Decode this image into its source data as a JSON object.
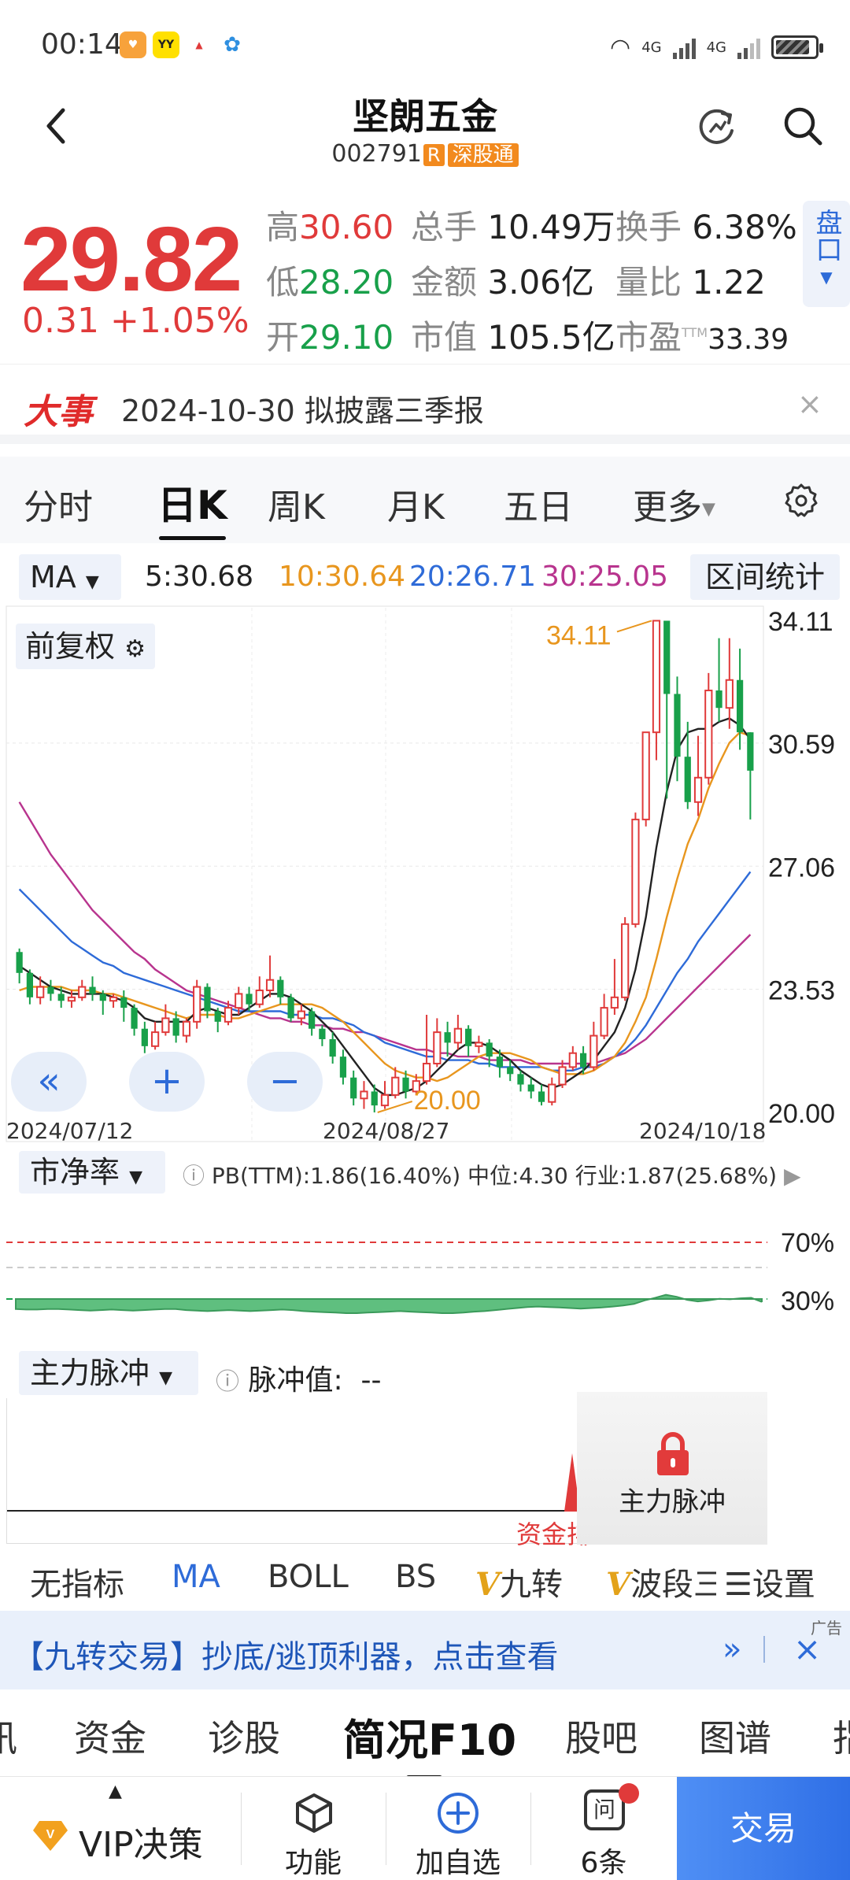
{
  "status_bar": {
    "time": "00:14",
    "network1": "4G",
    "network2": "4G"
  },
  "header": {
    "stock_name": "坚朗五金",
    "stock_code": "002791",
    "r_badge": "R",
    "exchange_badge": "深股通"
  },
  "quote": {
    "price": "29.82",
    "change": "0.31 +1.05%",
    "high_label": "高",
    "high": "30.60",
    "low_label": "低",
    "low": "28.20",
    "open_label": "开",
    "open": "29.10",
    "volume_label": "总手",
    "volume": "10.49万",
    "amount_label": "金额",
    "amount": "3.06亿",
    "mktcap_label": "市值",
    "mktcap": "105.5亿",
    "turnover_label": "换手",
    "turnover": "6.38%",
    "volratio_label": "量比",
    "volratio": "1.22",
    "pe_label": "市盈",
    "pe_sup": "TTM",
    "pe": "33.39",
    "pankou": "盘口"
  },
  "event": {
    "tag": "大事",
    "text": "2024-10-30 拟披露三季报",
    "close": "×"
  },
  "tabs": [
    "分时",
    "日K",
    "周K",
    "月K",
    "五日",
    "更多"
  ],
  "ma": {
    "select": "MA",
    "ma5": "5:30.68",
    "ma10": "10:30.64",
    "ma20": "20:26.71",
    "ma30": "30:25.05",
    "colors": {
      "ma5": "#222222",
      "ma10": "#e8961e",
      "ma20": "#2e6bd8",
      "ma30": "#b8348e"
    },
    "range_stat": "区间统计"
  },
  "chart": {
    "fuquan": "前复权",
    "high_mark": "34.11",
    "low_mark": "20.00",
    "dates": [
      "2024/07/12",
      "2024/08/27",
      "2024/10/18"
    ],
    "zoom": {
      "back": "«",
      "plus": "+",
      "minus": "−"
    },
    "up_color": "#e03a3a",
    "down_color": "#18a04a"
  },
  "chart_data": {
    "type": "candlestick",
    "ylim": [
      20.0,
      34.11
    ],
    "y_ticks": [
      "34.11",
      "30.59",
      "27.06",
      "23.53",
      "20.00"
    ],
    "candles": [
      [
        24.6,
        24.0,
        24.7,
        23.7
      ],
      [
        24.0,
        23.3,
        24.1,
        23.1
      ],
      [
        23.3,
        23.6,
        23.9,
        23.1
      ],
      [
        23.6,
        23.4,
        23.8,
        23.2
      ],
      [
        23.4,
        23.2,
        23.6,
        23.0
      ],
      [
        23.2,
        23.3,
        23.5,
        23.0
      ],
      [
        23.3,
        23.6,
        23.8,
        23.2
      ],
      [
        23.6,
        23.4,
        23.9,
        23.2
      ],
      [
        23.4,
        23.2,
        23.5,
        22.8
      ],
      [
        23.2,
        23.3,
        23.4,
        23.0
      ],
      [
        23.3,
        23.0,
        23.5,
        22.6
      ],
      [
        23.0,
        22.4,
        23.1,
        22.2
      ],
      [
        22.4,
        21.9,
        22.6,
        21.7
      ],
      [
        21.9,
        22.3,
        22.6,
        21.8
      ],
      [
        22.3,
        22.7,
        23.1,
        22.2
      ],
      [
        22.7,
        22.2,
        22.9,
        22.0
      ],
      [
        22.2,
        22.6,
        22.7,
        22.0
      ],
      [
        22.6,
        23.6,
        23.8,
        22.4
      ],
      [
        23.6,
        22.9,
        23.7,
        22.7
      ],
      [
        22.9,
        22.6,
        23.0,
        22.3
      ],
      [
        22.6,
        23.0,
        23.2,
        22.5
      ],
      [
        23.0,
        23.4,
        23.6,
        22.8
      ],
      [
        23.4,
        23.1,
        23.6,
        22.9
      ],
      [
        23.1,
        23.5,
        23.9,
        23.0
      ],
      [
        23.5,
        23.8,
        24.5,
        23.3
      ],
      [
        23.8,
        23.3,
        23.9,
        23.1
      ],
      [
        23.3,
        22.7,
        23.4,
        22.6
      ],
      [
        22.7,
        22.9,
        23.1,
        22.5
      ],
      [
        22.9,
        22.4,
        23.0,
        22.2
      ],
      [
        22.4,
        22.1,
        22.5,
        21.9
      ],
      [
        22.1,
        21.6,
        22.3,
        21.4
      ],
      [
        21.6,
        21.0,
        21.8,
        20.8
      ],
      [
        21.0,
        20.4,
        21.2,
        20.2
      ],
      [
        20.4,
        20.6,
        20.9,
        20.1
      ],
      [
        20.6,
        20.2,
        20.8,
        20.0
      ],
      [
        20.2,
        20.5,
        20.9,
        20.1
      ],
      [
        20.5,
        21.0,
        21.3,
        20.4
      ],
      [
        21.0,
        20.6,
        21.2,
        20.4
      ],
      [
        20.6,
        20.9,
        21.1,
        20.5
      ],
      [
        20.9,
        21.4,
        22.8,
        20.8
      ],
      [
        21.4,
        22.3,
        22.7,
        21.3
      ],
      [
        22.3,
        22.0,
        22.6,
        21.6
      ],
      [
        22.0,
        22.4,
        22.8,
        21.8
      ],
      [
        22.4,
        21.9,
        22.5,
        21.6
      ],
      [
        21.9,
        22.0,
        22.2,
        21.7
      ],
      [
        22.0,
        21.6,
        22.1,
        21.3
      ],
      [
        21.6,
        21.3,
        21.8,
        21.0
      ],
      [
        21.3,
        21.1,
        21.5,
        20.9
      ],
      [
        21.1,
        20.8,
        21.2,
        20.6
      ],
      [
        20.8,
        20.6,
        21.0,
        20.4
      ],
      [
        20.6,
        20.3,
        20.8,
        20.2
      ],
      [
        20.3,
        20.8,
        21.0,
        20.2
      ],
      [
        20.8,
        21.3,
        21.5,
        20.7
      ],
      [
        21.3,
        21.7,
        21.9,
        21.2
      ],
      [
        21.7,
        21.3,
        21.9,
        21.1
      ],
      [
        21.3,
        22.2,
        22.6,
        21.2
      ],
      [
        22.2,
        23.0,
        23.4,
        22.1
      ],
      [
        23.0,
        23.3,
        24.4,
        22.8
      ],
      [
        23.3,
        25.4,
        25.6,
        23.2
      ],
      [
        25.4,
        28.4,
        28.6,
        25.3
      ],
      [
        28.4,
        30.9,
        30.9,
        28.2
      ],
      [
        30.9,
        34.1,
        34.1,
        30.1
      ],
      [
        34.1,
        32.0,
        34.1,
        29.0
      ],
      [
        32.0,
        30.2,
        32.5,
        29.5
      ],
      [
        30.2,
        28.9,
        31.2,
        28.7
      ],
      [
        28.9,
        29.6,
        30.8,
        28.5
      ],
      [
        29.6,
        32.1,
        32.6,
        29.4
      ],
      [
        32.1,
        31.6,
        33.6,
        31.2
      ],
      [
        31.6,
        32.4,
        33.6,
        31.0
      ],
      [
        32.4,
        30.9,
        33.3,
        30.4
      ],
      [
        30.9,
        29.8,
        30.9,
        28.4
      ]
    ],
    "ma5": [
      24.2,
      24.0,
      23.8,
      23.6,
      23.5,
      23.4,
      23.4,
      23.4,
      23.4,
      23.3,
      23.2,
      23.0,
      22.7,
      22.6,
      22.6,
      22.6,
      22.6,
      22.9,
      23.0,
      22.9,
      22.8,
      22.8,
      23.0,
      23.2,
      23.4,
      23.4,
      23.3,
      23.1,
      22.9,
      22.6,
      22.3,
      21.9,
      21.5,
      21.1,
      20.7,
      20.5,
      20.5,
      20.6,
      20.7,
      20.9,
      21.2,
      21.5,
      21.8,
      22.0,
      22.0,
      21.9,
      21.7,
      21.5,
      21.2,
      21.0,
      20.8,
      20.7,
      20.8,
      21.0,
      21.2,
      21.5,
      21.9,
      22.3,
      23.0,
      24.1,
      25.6,
      27.6,
      29.2,
      30.4,
      30.9,
      31.0,
      31.0,
      31.2,
      31.3,
      31.1,
      30.7
    ],
    "ma10": [
      23.5,
      23.6,
      23.6,
      23.6,
      23.6,
      23.5,
      23.5,
      23.5,
      23.4,
      23.4,
      23.3,
      23.2,
      23.1,
      23.0,
      22.9,
      22.8,
      22.7,
      22.8,
      22.8,
      22.8,
      22.7,
      22.7,
      22.8,
      22.9,
      23.0,
      23.1,
      23.1,
      23.1,
      23.1,
      23.0,
      22.8,
      22.6,
      22.3,
      22.0,
      21.7,
      21.4,
      21.2,
      21.1,
      21.0,
      21.0,
      20.9,
      21.0,
      21.2,
      21.4,
      21.6,
      21.7,
      21.7,
      21.7,
      21.6,
      21.5,
      21.3,
      21.2,
      21.1,
      21.1,
      21.1,
      21.2,
      21.4,
      21.6,
      22.0,
      22.6,
      23.3,
      24.4,
      25.6,
      26.7,
      27.7,
      28.4,
      29.3,
      30.0,
      30.6,
      30.9,
      30.8
    ],
    "ma20": [
      26.4,
      26.1,
      25.8,
      25.5,
      25.2,
      24.9,
      24.7,
      24.5,
      24.3,
      24.2,
      24.0,
      23.9,
      23.8,
      23.7,
      23.6,
      23.5,
      23.4,
      23.3,
      23.2,
      23.1,
      23.0,
      22.9,
      22.9,
      22.9,
      22.9,
      22.9,
      22.8,
      22.8,
      22.8,
      22.7,
      22.7,
      22.6,
      22.5,
      22.3,
      22.2,
      22.0,
      21.9,
      21.8,
      21.7,
      21.6,
      21.6,
      21.5,
      21.5,
      21.5,
      21.4,
      21.4,
      21.3,
      21.3,
      21.3,
      21.3,
      21.3,
      21.2,
      21.2,
      21.2,
      21.3,
      21.3,
      21.4,
      21.6,
      21.8,
      22.1,
      22.5,
      23.0,
      23.5,
      24.0,
      24.4,
      24.9,
      25.3,
      25.7,
      26.1,
      26.5,
      26.9
    ],
    "ma30": [
      28.9,
      28.4,
      27.9,
      27.4,
      27.0,
      26.6,
      26.2,
      25.8,
      25.5,
      25.2,
      24.9,
      24.6,
      24.4,
      24.1,
      23.9,
      23.7,
      23.5,
      23.4,
      23.3,
      23.2,
      23.1,
      23.0,
      22.9,
      22.8,
      22.7,
      22.7,
      22.6,
      22.6,
      22.5,
      22.5,
      22.4,
      22.4,
      22.3,
      22.3,
      22.2,
      22.1,
      22.0,
      21.9,
      21.8,
      21.8,
      21.7,
      21.7,
      21.6,
      21.6,
      21.6,
      21.5,
      21.5,
      21.5,
      21.5,
      21.4,
      21.4,
      21.4,
      21.4,
      21.4,
      21.4,
      21.4,
      21.5,
      21.6,
      21.7,
      21.9,
      22.1,
      22.4,
      22.7,
      23.0,
      23.3,
      23.6,
      23.9,
      24.2,
      24.5,
      24.8,
      25.1
    ]
  },
  "pb": {
    "select": "市净率",
    "info": "PB(TTM):1.86(16.40%)    中位:4.30    行业:1.87(25.68%)",
    "level_70": "70%",
    "level_30": "30%",
    "fill_color": "#5fbf7f",
    "series": [
      0.88,
      0.87,
      0.87,
      0.88,
      0.88,
      0.87,
      0.86,
      0.85,
      0.86,
      0.87,
      0.86,
      0.85,
      0.86,
      0.87,
      0.88,
      0.88,
      0.86,
      0.85,
      0.84,
      0.85,
      0.86,
      0.85,
      0.84,
      0.85,
      0.86,
      0.87,
      0.86,
      0.84,
      0.83,
      0.82,
      0.81,
      0.8,
      0.8,
      0.81,
      0.82,
      0.83,
      0.84,
      0.83,
      0.82,
      0.81,
      0.8,
      0.8,
      0.81,
      0.83,
      0.84,
      0.86,
      0.88,
      0.9,
      0.92,
      0.93,
      0.92,
      0.91,
      0.9,
      0.89,
      0.9,
      0.91,
      0.93,
      0.95,
      0.98,
      1.05,
      1.1,
      1.16,
      1.12,
      1.06,
      1.03,
      1.05,
      1.08,
      1.07,
      1.09,
      1.1,
      1.02
    ]
  },
  "pulse": {
    "select": "主力脉冲",
    "info_label": "脉冲值:",
    "info_value": "--",
    "lock_label": "主力脉冲",
    "fund_label": "资金排"
  },
  "indicators": {
    "none": "无指标",
    "ma": "MA",
    "boll": "BOLL",
    "bs": "BS",
    "v": "V",
    "jiuzhuan": "九转",
    "boduan": "波段三",
    "settings": "设置"
  },
  "ad": {
    "text": "【九转交易】抄底/逃顶利器，点击查看",
    "tag": "广告",
    "more": "»",
    "close": "×"
  },
  "section_tabs": [
    "讯",
    "资金",
    "诊股",
    "简况F10",
    "股吧",
    "图谱",
    "指"
  ],
  "bottom_nav": {
    "vip": "VIP决策",
    "func": "功能",
    "add": "加自选",
    "msg": "6条",
    "msg_icon": "问",
    "trade": "交易"
  }
}
